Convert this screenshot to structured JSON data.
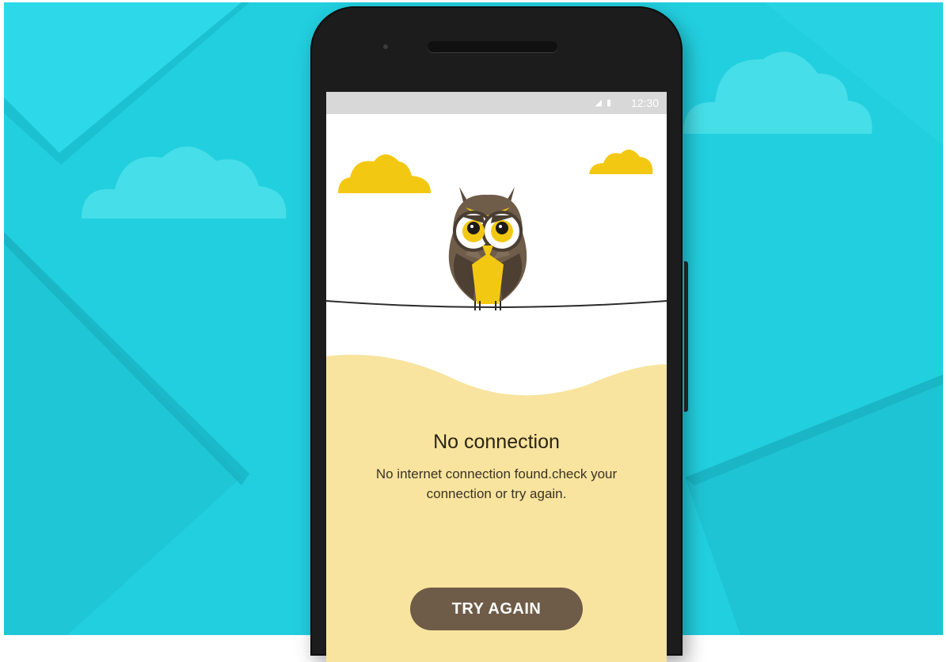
{
  "status_bar": {
    "time": "12:30",
    "icons": [
      "signal-icon",
      "lock-icon"
    ]
  },
  "illustration": {
    "subject": "owl-icon",
    "decorations": [
      "cloud-icon",
      "cloud-icon"
    ]
  },
  "error_screen": {
    "title": "No connection",
    "message_line1": "No internet connection found.check your",
    "message_line2": "connection or try again.",
    "retry_label": "TRY AGAIN"
  },
  "colors": {
    "background": "#22cfdf",
    "sand": "#f8e49e",
    "button": "#6e5b48",
    "cloud": "#f3c812"
  }
}
